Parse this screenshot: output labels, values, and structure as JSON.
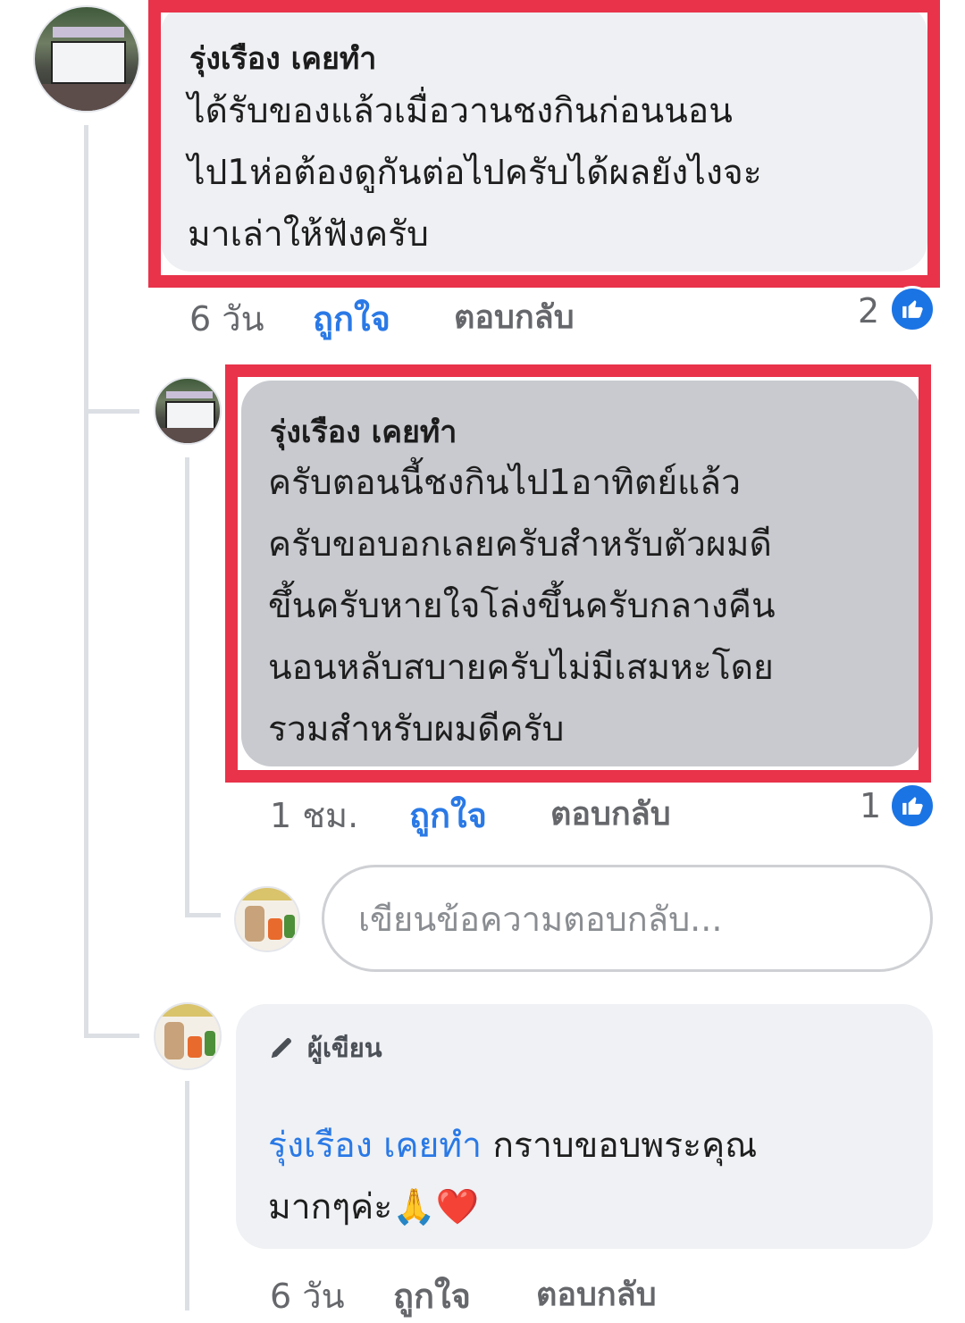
{
  "comment": {
    "author": "รุ่งเรือง เคยทำ",
    "lines": [
      "ได้รับของแล้วเมื่อวานชงกินก่อนนอน",
      "ไป1ห่อต้องดูกันต่อไปครับได้ผลยังไงจะ",
      "มาเล่าให้ฟังครับ"
    ],
    "time": "6 วัน",
    "like_label": "ถูกใจ",
    "reply_label": "ตอบกลับ",
    "reaction_count": "2"
  },
  "reply1": {
    "author": "รุ่งเรือง เคยทำ",
    "lines": [
      "ครับตอนนี้ชงกินไป1อาทิตย์แล้ว",
      "ครับขอบอกเลยครับสำหรับตัวผมดี",
      "ขึ้นครับหายใจโล่งขึ้นครับกลางคืน",
      "นอนหลับสบายครับไม่มีเสมหะโดย",
      "รวมสำหรับผมดีครับ"
    ],
    "time": "1 ชม.",
    "like_label": "ถูกใจ",
    "reply_label": "ตอบกลับ",
    "reaction_count": "1"
  },
  "reply_input": {
    "placeholder": "เขียนข้อความตอบกลับ..."
  },
  "author_reply": {
    "badge": "ผู้เขียน",
    "mention": "รุ่งเรือง เคยทำ",
    "text_line1": " กราบขอบพระคุณ",
    "text_line2": "มากๆค่ะ🙏❤️",
    "time": "6 วัน",
    "like_label": "ถูกใจ",
    "reply_label": "ตอบกลับ"
  },
  "colors": {
    "highlight": "#e8334a",
    "link": "#2a79e6",
    "like_badge": "#1b74e4"
  },
  "icons": {
    "like": "thumbs-up-icon",
    "author": "pencil-icon"
  }
}
